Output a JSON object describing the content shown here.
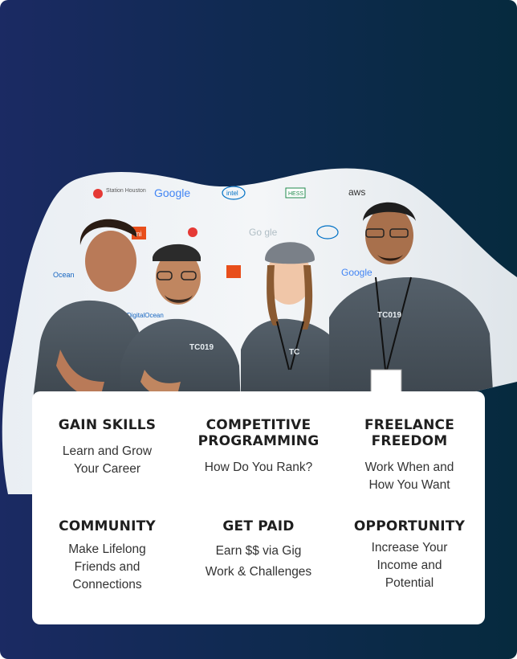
{
  "colors": {
    "background_left": "#1b2a63",
    "background_right": "#062a3e",
    "card": "#ffffff",
    "text": "#1f1f1f"
  },
  "photo": {
    "backdrop_logos": [
      "Station Houston",
      "Google",
      "intel",
      "HESS",
      "aws",
      "mi",
      "Ocean",
      "DigitalOcean",
      "Google"
    ],
    "shirt_logo": "TC019"
  },
  "features": [
    {
      "title": "GAIN SKILLS",
      "desc": "Learn and Grow\nYour Career"
    },
    {
      "title": "COMPETITIVE\nPROGRAMMING",
      "desc": "How Do You Rank?"
    },
    {
      "title": "FREELANCE\nFREEDOM",
      "desc": "Work When and\nHow You Want"
    },
    {
      "title": "COMMUNITY",
      "desc": "Make Lifelong\nFriends and\nConnections"
    },
    {
      "title": "GET PAID",
      "desc": "Earn $$ via Gig\nWork & Challenges"
    },
    {
      "title": "OPPORTUNITY",
      "desc": "Increase Your\nIncome and\nPotential"
    }
  ]
}
